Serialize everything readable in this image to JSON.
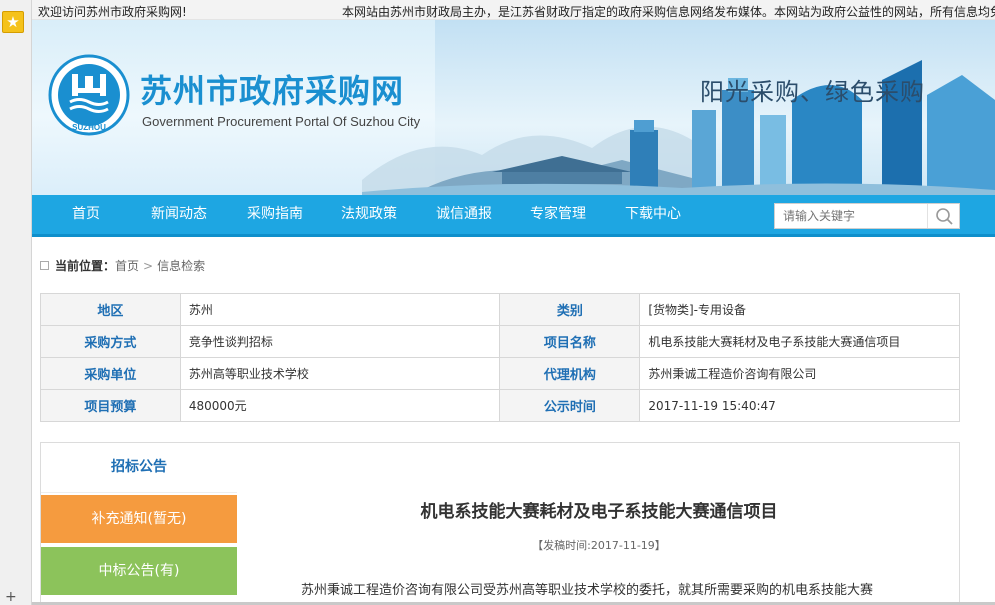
{
  "browser": {
    "favorite_icon": "star-icon",
    "add_icon": "plus-icon"
  },
  "topbar": {
    "welcome": "欢迎访问苏州市政府采购网!",
    "notice": "本网站由苏州市财政局主办，是江苏省财政厅指定的政府采购信息网络发布媒体。本网站为政府公益性的网站，所有信息均免"
  },
  "header": {
    "logo_text": "SUZHOU",
    "title": "苏州市政府采购网",
    "subtitle": "Government Procurement Portal Of Suzhou City",
    "slogan": "阳光采购、绿色采购"
  },
  "nav": {
    "items": [
      "首页",
      "新闻动态",
      "采购指南",
      "法规政策",
      "诚信通报",
      "专家管理",
      "下载中心"
    ],
    "search_placeholder": "请输入关键字",
    "search_icon": "search-icon"
  },
  "breadcrumb": {
    "label": "当前位置：",
    "items": [
      "首页",
      "信息检索"
    ]
  },
  "info": {
    "rows": [
      {
        "k1": "地区",
        "v1": "苏州",
        "k2": "类别",
        "v2": "[货物类]-专用设备"
      },
      {
        "k1": "采购方式",
        "v1": "竞争性谈判招标",
        "k2": "项目名称",
        "v2": "机电系技能大赛耗材及电子系技能大赛通信项目"
      },
      {
        "k1": "采购单位",
        "v1": "苏州高等职业技术学校",
        "k2": "代理机构",
        "v2": "苏州秉诚工程造价咨询有限公司"
      },
      {
        "k1": "项目预算",
        "v1": "480000元",
        "k2": "公示时间",
        "v2": "2017-11-19 15:40:47"
      }
    ]
  },
  "tabs": {
    "tender": "招标公告",
    "supplement": "补充通知(暂无)",
    "award": "中标公告(有)"
  },
  "article": {
    "title": "机电系技能大赛耗材及电子系技能大赛通信项目",
    "date": "【发稿时间:2017-11-19】",
    "body": "苏州秉诚工程造价咨询有限公司受苏州高等职业技术学校的委托，就其所需要采购的机电系技能大赛"
  },
  "colors": {
    "nav": "#1ea6e2",
    "title": "#1a8fd0",
    "tab_orange": "#f59b3f",
    "tab_green": "#8cc35b",
    "label_blue": "#1f6fb4"
  }
}
